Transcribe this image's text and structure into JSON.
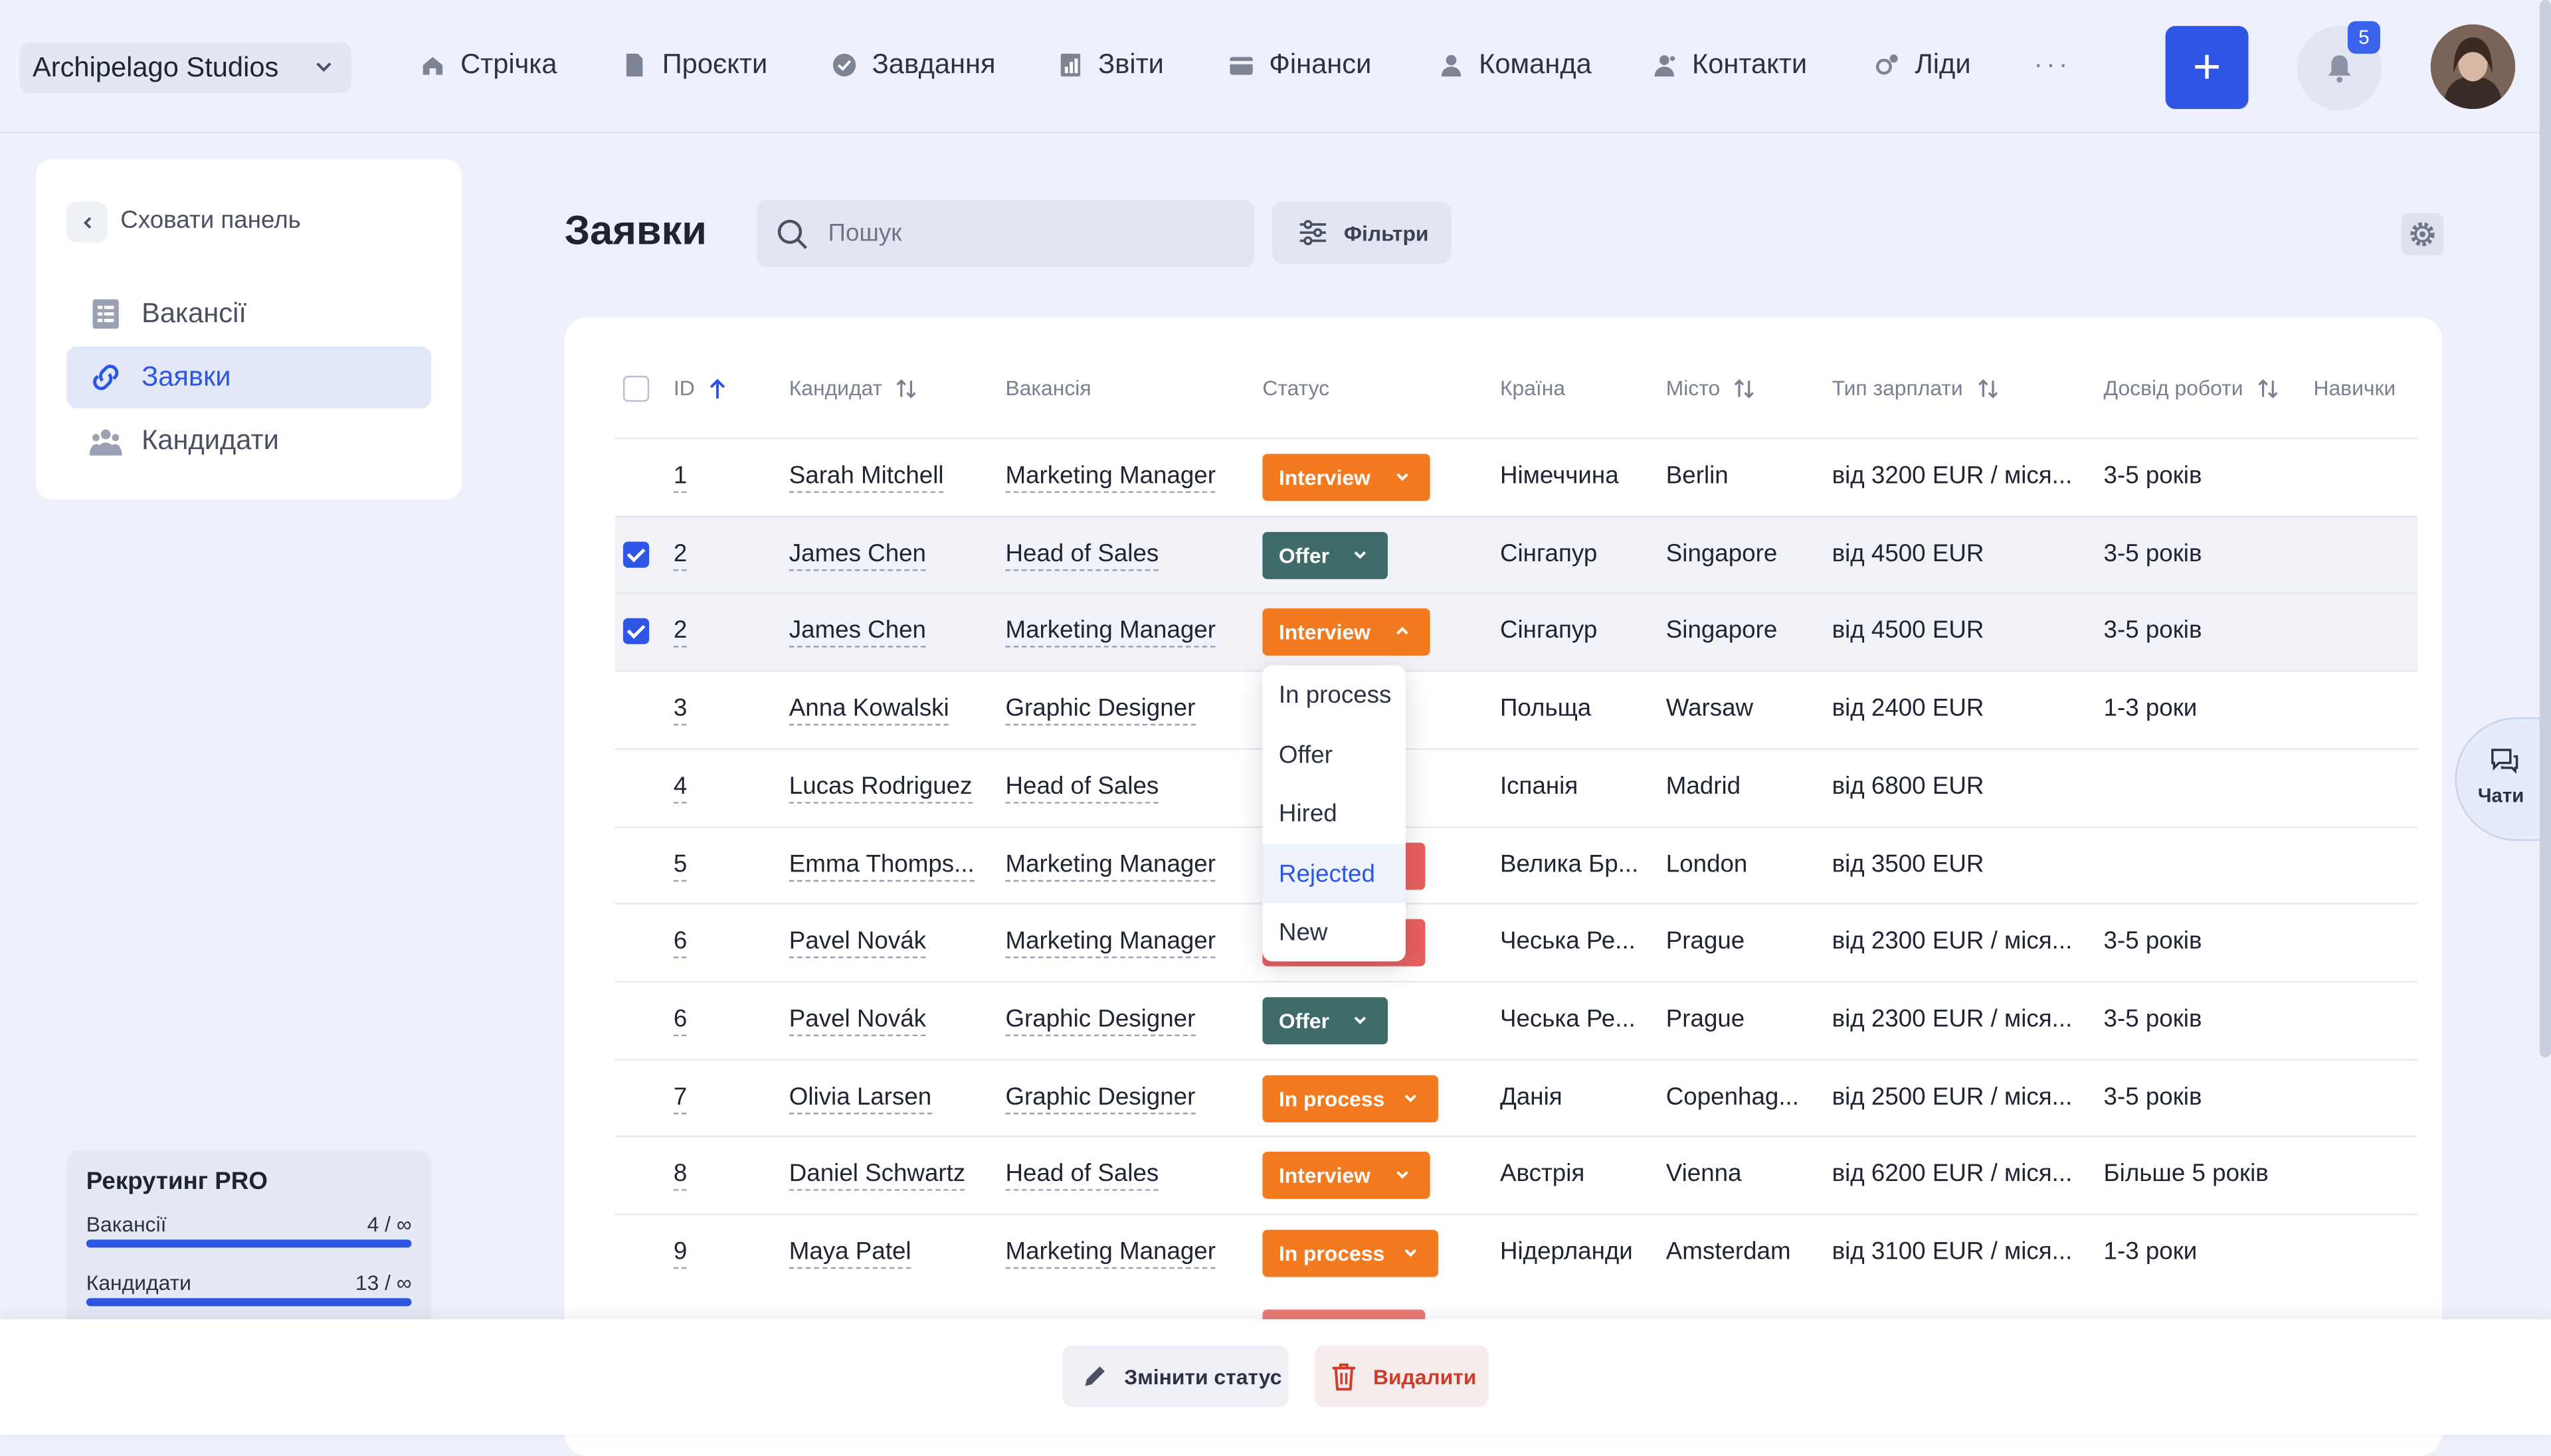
{
  "company": "Archipelago Studios",
  "nav": [
    "Стрічка",
    "Проєкти",
    "Завдання",
    "Звіти",
    "Фінанси",
    "Команда",
    "Контакти",
    "Ліди"
  ],
  "nav_more": "···",
  "plus": "+",
  "notifications": "5",
  "sidebar": {
    "hide": "Сховати панель",
    "items": [
      "Вакансії",
      "Заявки",
      "Кандидати"
    ],
    "active": "Заявки",
    "plan": {
      "title": "Рекрутинг PRO",
      "rows": [
        {
          "label": "Вакансії",
          "value": "4 / ∞",
          "fill": 1.0
        },
        {
          "label": "Кандидати",
          "value": "13 / ∞",
          "fill": 1.0
        }
      ]
    }
  },
  "page": {
    "title": "Заявки",
    "search_placeholder": "Пошук",
    "filters": "Фільтри"
  },
  "table": {
    "headers": [
      "ID",
      "Кандидат",
      "Вакансія",
      "Статус",
      "Країна",
      "Місто",
      "Тип зарплати",
      "Досвід роботи",
      "Навички"
    ],
    "rows": [
      {
        "id": "1",
        "candidate": "Sarah Mitchell",
        "vacancy": "Marketing Manager",
        "status": "Interview",
        "country": "Німеччина",
        "city": "Berlin",
        "salary": "від 3200 EUR / міся...",
        "experience": "3-5 років",
        "selected": false
      },
      {
        "id": "2",
        "candidate": "James Chen",
        "vacancy": "Head of Sales",
        "status": "Offer",
        "country": "Сінгапур",
        "city": "Singapore",
        "salary": "від 4500 EUR",
        "experience": "3-5 років",
        "selected": true
      },
      {
        "id": "2",
        "candidate": "James Chen",
        "vacancy": "Marketing Manager",
        "status": "Interview",
        "country": "Сінгапур",
        "city": "Singapore",
        "salary": "від 4500 EUR",
        "experience": "3-5 років",
        "selected": true
      },
      {
        "id": "3",
        "candidate": "Anna Kowalski",
        "vacancy": "Graphic Designer",
        "status": "",
        "country": "Польща",
        "city": "Warsaw",
        "salary": "від 2400 EUR",
        "experience": "1-3 роки",
        "selected": false
      },
      {
        "id": "4",
        "candidate": "Lucas Rodriguez",
        "vacancy": "Head of Sales",
        "status": "",
        "country": "Іспанія",
        "city": "Madrid",
        "salary": "від 6800 EUR",
        "experience": "",
        "selected": false
      },
      {
        "id": "5",
        "candidate": "Emma Thomps...",
        "vacancy": "Marketing Manager",
        "status": "",
        "country": "Велика Бр...",
        "city": "London",
        "salary": "від 3500 EUR",
        "experience": "",
        "selected": false
      },
      {
        "id": "6",
        "candidate": "Pavel Novák",
        "vacancy": "Marketing Manager",
        "status": "",
        "country": "Чеська Ре...",
        "city": "Prague",
        "salary": "від 2300 EUR / міся...",
        "experience": "3-5 років",
        "selected": false
      },
      {
        "id": "6",
        "candidate": "Pavel Novák",
        "vacancy": "Graphic Designer",
        "status": "Offer",
        "country": "Чеська Ре...",
        "city": "Prague",
        "salary": "від 2300 EUR / міся...",
        "experience": "3-5 років",
        "selected": false
      },
      {
        "id": "7",
        "candidate": "Olivia Larsen",
        "vacancy": "Graphic Designer",
        "status": "In process",
        "country": "Данія",
        "city": "Copenhag...",
        "salary": "від 2500 EUR / міся...",
        "experience": "3-5 років",
        "selected": false
      },
      {
        "id": "8",
        "candidate": "Daniel Schwartz",
        "vacancy": "Head of Sales",
        "status": "Interview",
        "country": "Австрія",
        "city": "Vienna",
        "salary": "від 6200 EUR / міся...",
        "experience": "Більше 5 років",
        "selected": false
      },
      {
        "id": "9",
        "candidate": "Maya Patel",
        "vacancy": "Marketing Manager",
        "status": "In process",
        "country": "Нідерланди",
        "city": "Amsterdam",
        "salary": "від 3100 EUR / міся...",
        "experience": "1-3 роки",
        "selected": false
      }
    ]
  },
  "dropdown": {
    "options": [
      "In process",
      "Offer",
      "Hired",
      "Rejected",
      "New"
    ],
    "highlighted": "Rejected"
  },
  "status_colors": {
    "Interview": "#f47a1f",
    "Offer": "#3e6b68",
    "In process": "#f47a1f",
    "Rejected": "#e8605e"
  },
  "chats": "Чати",
  "bottom": {
    "change_status": "Змінити статус",
    "delete": "Видалити"
  }
}
